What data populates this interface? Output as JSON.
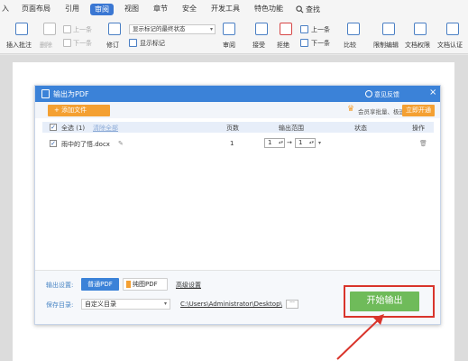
{
  "menu": {
    "items": [
      "入",
      "页面布局",
      "引用",
      "审阅",
      "视图",
      "章节",
      "安全",
      "开发工具",
      "特色功能"
    ],
    "active_index": 3,
    "search_label": "查找"
  },
  "ribbon": {
    "insert_comment": "插入批注",
    "delete": "删除",
    "prev": "上一条",
    "next": "下一条",
    "revise": "修订",
    "markup_state": "显示标记的最终状态",
    "show_markup": "显示标记",
    "review": "审阅",
    "accept": "接受",
    "reject": "拒绝",
    "prev2": "上一条",
    "next2": "下一条",
    "compare": "比较",
    "restrict_edit": "限制编辑",
    "doc_permission": "文档权限",
    "doc_auth": "文档认证"
  },
  "dialog": {
    "title": "输出为PDF",
    "feedback": "意见反馈",
    "close": "×",
    "add_file": "+ 添加文件",
    "vip_text": "会员享批量、极速转换",
    "vip_button": "立即开通",
    "table": {
      "select_all": "全选 (1)",
      "clear_all": "清除全部",
      "headers": [
        "页数",
        "输出范围",
        "状态",
        "操作"
      ],
      "rows": [
        {
          "filename": "雨中的了悟.docx",
          "pages": "1",
          "range_from": "1",
          "range_arrow": "→",
          "range_to": "1"
        }
      ]
    },
    "output_settings_label": "输出设置:",
    "normal_pdf": "普通PDF",
    "pure_pdf": "纯图PDF",
    "advanced": "高级设置",
    "save_dir_label": "保存目录:",
    "save_dir_value": "自定义目录",
    "path": "C:\\Users\\Administrator\\Desktop\\",
    "browse": "···",
    "start_button": "开始输出"
  },
  "colors": {
    "accent_blue": "#3b82d8",
    "orange": "#f4a032",
    "green": "#6fbb5a",
    "highlight_red": "#d9342b"
  }
}
